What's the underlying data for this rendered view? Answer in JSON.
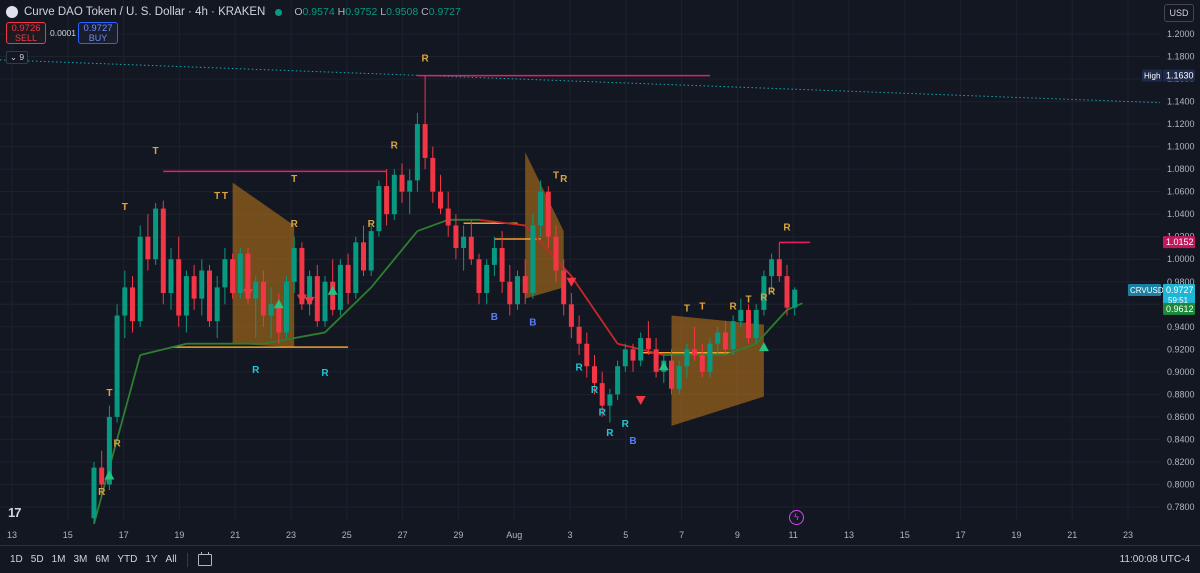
{
  "header": {
    "title": "Curve DAO Token / U. S. Dollar · 4h · KRAKEN",
    "ohlc": [
      {
        "k": "O",
        "v": "0.9574"
      },
      {
        "k": "H",
        "v": "0.9752"
      },
      {
        "k": "L",
        "v": "0.9508"
      },
      {
        "k": "C",
        "v": "0.9727"
      }
    ]
  },
  "trade": {
    "sell_price": "0.9726",
    "sell_label": "SELL",
    "spread": "0.0001",
    "buy_price": "0.9727",
    "buy_label": "BUY"
  },
  "indicators_toggle": "9",
  "currency": "USD",
  "colors": {
    "bg": "#131722",
    "up": "#089981",
    "down": "#f23645",
    "amber": "#d9a441",
    "magenta": "#e91e63",
    "orange": "#f59e2d",
    "cyan": "#22c6d6",
    "trail_green": "#2e7d32",
    "trail_red": "#c62828"
  },
  "chart_data": {
    "type": "candlestick",
    "ylim": [
      0.77,
      1.22
    ],
    "yticks": [
      "1.2000",
      "1.1800",
      "1.1600",
      "1.1400",
      "1.1200",
      "1.1000",
      "1.0800",
      "1.0600",
      "1.0400",
      "1.0200",
      "1.0000",
      "0.9800",
      "0.9600",
      "0.9400",
      "0.9200",
      "0.9000",
      "0.8800",
      "0.8600",
      "0.8400",
      "0.8200",
      "0.8000",
      "0.7800"
    ],
    "xticks": [
      "13",
      "15",
      "17",
      "19",
      "21",
      "23",
      "25",
      "27",
      "29",
      "Aug",
      "3",
      "5",
      "7",
      "9",
      "11",
      "13",
      "15",
      "17",
      "19",
      "21",
      "23"
    ],
    "price_labels": [
      {
        "name": "High",
        "value": "1.1630"
      },
      {
        "name": "",
        "value": "1.0152"
      },
      {
        "name": "CRVUSD",
        "value": "0.9727",
        "countdown": "59:51"
      },
      {
        "name": "",
        "value": "0.9612"
      }
    ],
    "candles": [
      [
        0.77,
        0.82,
        0.765,
        0.815
      ],
      [
        0.815,
        0.83,
        0.79,
        0.8
      ],
      [
        0.8,
        0.87,
        0.795,
        0.86
      ],
      [
        0.86,
        0.96,
        0.855,
        0.95
      ],
      [
        0.95,
        0.99,
        0.93,
        0.975
      ],
      [
        0.975,
        0.985,
        0.935,
        0.945
      ],
      [
        0.945,
        1.03,
        0.94,
        1.02
      ],
      [
        1.02,
        1.04,
        0.99,
        1.0
      ],
      [
        1.0,
        1.05,
        0.995,
        1.045
      ],
      [
        1.045,
        1.052,
        0.96,
        0.97
      ],
      [
        0.97,
        1.01,
        0.955,
        1.0
      ],
      [
        1.0,
        1.02,
        0.94,
        0.95
      ],
      [
        0.95,
        0.99,
        0.935,
        0.985
      ],
      [
        0.985,
        0.995,
        0.955,
        0.965
      ],
      [
        0.965,
        1.0,
        0.95,
        0.99
      ],
      [
        0.99,
        0.995,
        0.94,
        0.945
      ],
      [
        0.945,
        0.985,
        0.93,
        0.975
      ],
      [
        0.975,
        1.01,
        0.96,
        1.0
      ],
      [
        1.0,
        1.005,
        0.965,
        0.97
      ],
      [
        0.97,
        1.01,
        0.965,
        1.005
      ],
      [
        1.005,
        1.01,
        0.96,
        0.965
      ],
      [
        0.965,
        0.985,
        0.93,
        0.98
      ],
      [
        0.98,
        0.99,
        0.94,
        0.95
      ],
      [
        0.95,
        0.975,
        0.93,
        0.96
      ],
      [
        0.96,
        0.97,
        0.925,
        0.935
      ],
      [
        0.935,
        0.985,
        0.93,
        0.98
      ],
      [
        0.98,
        1.02,
        0.97,
        1.01
      ],
      [
        1.01,
        1.015,
        0.955,
        0.96
      ],
      [
        0.96,
        0.99,
        0.95,
        0.985
      ],
      [
        0.985,
        0.995,
        0.94,
        0.945
      ],
      [
        0.945,
        0.985,
        0.94,
        0.98
      ],
      [
        0.98,
        1.0,
        0.95,
        0.955
      ],
      [
        0.955,
        1.0,
        0.95,
        0.995
      ],
      [
        0.995,
        1.005,
        0.96,
        0.97
      ],
      [
        0.97,
        1.02,
        0.965,
        1.015
      ],
      [
        1.015,
        1.03,
        0.985,
        0.99
      ],
      [
        0.99,
        1.03,
        0.985,
        1.025
      ],
      [
        1.025,
        1.07,
        1.02,
        1.065
      ],
      [
        1.065,
        1.08,
        1.03,
        1.04
      ],
      [
        1.04,
        1.08,
        1.035,
        1.075
      ],
      [
        1.075,
        1.085,
        1.05,
        1.06
      ],
      [
        1.06,
        1.08,
        1.04,
        1.07
      ],
      [
        1.07,
        1.13,
        1.06,
        1.12
      ],
      [
        1.12,
        1.163,
        1.08,
        1.09
      ],
      [
        1.09,
        1.1,
        1.05,
        1.06
      ],
      [
        1.06,
        1.075,
        1.04,
        1.045
      ],
      [
        1.045,
        1.06,
        1.02,
        1.03
      ],
      [
        1.03,
        1.04,
        1.0,
        1.01
      ],
      [
        1.01,
        1.03,
        0.99,
        1.02
      ],
      [
        1.02,
        1.035,
        0.995,
        1.0
      ],
      [
        1.0,
        1.005,
        0.96,
        0.97
      ],
      [
        0.97,
        1.0,
        0.96,
        0.995
      ],
      [
        0.995,
        1.02,
        0.985,
        1.01
      ],
      [
        1.01,
        1.025,
        0.97,
        0.98
      ],
      [
        0.98,
        0.995,
        0.95,
        0.96
      ],
      [
        0.96,
        0.99,
        0.955,
        0.985
      ],
      [
        0.985,
        1.0,
        0.96,
        0.97
      ],
      [
        0.97,
        1.04,
        0.965,
        1.03
      ],
      [
        1.03,
        1.07,
        1.02,
        1.06
      ],
      [
        1.06,
        1.065,
        1.01,
        1.02
      ],
      [
        1.02,
        1.03,
        0.98,
        0.99
      ],
      [
        0.99,
        1.0,
        0.95,
        0.96
      ],
      [
        0.96,
        0.97,
        0.93,
        0.94
      ],
      [
        0.94,
        0.95,
        0.915,
        0.925
      ],
      [
        0.925,
        0.935,
        0.895,
        0.905
      ],
      [
        0.905,
        0.915,
        0.88,
        0.89
      ],
      [
        0.89,
        0.9,
        0.86,
        0.87
      ],
      [
        0.87,
        0.885,
        0.855,
        0.88
      ],
      [
        0.88,
        0.91,
        0.875,
        0.905
      ],
      [
        0.905,
        0.925,
        0.9,
        0.92
      ],
      [
        0.92,
        0.925,
        0.9,
        0.91
      ],
      [
        0.91,
        0.935,
        0.905,
        0.93
      ],
      [
        0.93,
        0.945,
        0.915,
        0.92
      ],
      [
        0.92,
        0.93,
        0.895,
        0.9
      ],
      [
        0.9,
        0.915,
        0.89,
        0.91
      ],
      [
        0.91,
        0.92,
        0.88,
        0.885
      ],
      [
        0.885,
        0.91,
        0.88,
        0.905
      ],
      [
        0.905,
        0.925,
        0.895,
        0.92
      ],
      [
        0.92,
        0.94,
        0.91,
        0.915
      ],
      [
        0.915,
        0.925,
        0.895,
        0.9
      ],
      [
        0.9,
        0.93,
        0.895,
        0.925
      ],
      [
        0.925,
        0.94,
        0.915,
        0.935
      ],
      [
        0.935,
        0.945,
        0.915,
        0.92
      ],
      [
        0.92,
        0.95,
        0.915,
        0.945
      ],
      [
        0.945,
        0.965,
        0.94,
        0.955
      ],
      [
        0.955,
        0.96,
        0.925,
        0.93
      ],
      [
        0.93,
        0.96,
        0.925,
        0.955
      ],
      [
        0.955,
        0.99,
        0.95,
        0.985
      ],
      [
        0.985,
        1.005,
        0.97,
        1.0
      ],
      [
        1.0,
        1.015,
        0.98,
        0.985
      ],
      [
        0.985,
        0.995,
        0.95,
        0.957
      ],
      [
        0.957,
        0.975,
        0.95,
        0.973
      ]
    ],
    "trail": [
      {
        "i": 0,
        "v": 0.765
      },
      {
        "i": 6,
        "v": 0.915
      },
      {
        "i": 12,
        "v": 0.925
      },
      {
        "i": 22,
        "v": 0.925
      },
      {
        "i": 30,
        "v": 0.935
      },
      {
        "i": 36,
        "v": 0.975
      },
      {
        "i": 42,
        "v": 1.025
      },
      {
        "i": 46,
        "v": 1.035
      },
      {
        "i": 50,
        "v": 1.035,
        "bear": true
      },
      {
        "i": 56,
        "v": 1.03,
        "bear": true
      },
      {
        "i": 62,
        "v": 0.985,
        "bear": true
      },
      {
        "i": 68,
        "v": 0.925,
        "bear": true
      },
      {
        "i": 71,
        "v": 0.92,
        "bear": true
      },
      {
        "i": 74,
        "v": 0.915
      },
      {
        "i": 82,
        "v": 0.915
      },
      {
        "i": 86,
        "v": 0.925
      },
      {
        "i": 90,
        "v": 0.955
      },
      {
        "i": 92,
        "v": 0.961
      }
    ],
    "levels": [
      {
        "i0": 9,
        "i1": 38,
        "v": 1.078,
        "color": "magenta"
      },
      {
        "i0": 42,
        "i1": 80,
        "v": 1.163,
        "color": "magenta"
      },
      {
        "i0": 89,
        "i1": 93,
        "v": 1.015,
        "color": "magenta"
      },
      {
        "i0": 10,
        "i1": 33,
        "v": 0.922,
        "color": "orange"
      },
      {
        "i0": 48,
        "i1": 55,
        "v": 1.032,
        "color": "orange"
      },
      {
        "i0": 52,
        "i1": 58,
        "v": 1.018,
        "color": "orange"
      },
      {
        "i0": 71,
        "i1": 83,
        "v": 0.917,
        "color": "orange"
      }
    ],
    "zones": [
      {
        "i0": 18,
        "i1": 26,
        "top": [
          1.068,
          1.03
        ],
        "bot": [
          0.925,
          0.922
        ]
      },
      {
        "i0": 56,
        "i1": 61,
        "top": [
          1.095,
          1.025
        ],
        "bot": [
          0.965,
          0.975
        ]
      },
      {
        "i0": 75,
        "i1": 87,
        "top": [
          0.95,
          0.942
        ],
        "bot": [
          0.852,
          0.878
        ]
      }
    ],
    "markers": [
      {
        "i": 1,
        "v": 0.787,
        "t": "R",
        "pos": "above",
        "c": "amber"
      },
      {
        "i": 3,
        "v": 0.83,
        "t": "R",
        "pos": "above",
        "c": "amber"
      },
      {
        "i": 2,
        "v": 0.875,
        "t": "T",
        "pos": "above",
        "c": "orange"
      },
      {
        "i": 4,
        "v": 1.04,
        "t": "T",
        "pos": "above",
        "c": "orange"
      },
      {
        "i": 8,
        "v": 1.09,
        "t": "T",
        "pos": "above",
        "c": "amber"
      },
      {
        "i": 16,
        "v": 1.05,
        "t": "T",
        "pos": "above",
        "c": "amber"
      },
      {
        "i": 17,
        "v": 1.05,
        "t": "T",
        "pos": "above",
        "c": "amber"
      },
      {
        "i": 26,
        "v": 1.065,
        "t": "T",
        "pos": "above",
        "c": "amber"
      },
      {
        "i": 26,
        "v": 1.025,
        "t": "R",
        "pos": "above",
        "c": "amber"
      },
      {
        "i": 36,
        "v": 1.025,
        "t": "R",
        "pos": "above",
        "c": "amber"
      },
      {
        "i": 39,
        "v": 1.095,
        "t": "R",
        "pos": "above",
        "c": "amber"
      },
      {
        "i": 43,
        "v": 1.172,
        "t": "R",
        "pos": "above",
        "c": "amber"
      },
      {
        "i": 60,
        "v": 1.068,
        "t": "T",
        "pos": "above",
        "c": "amber"
      },
      {
        "i": 61,
        "v": 1.065,
        "t": "R",
        "pos": "above",
        "c": "amber"
      },
      {
        "i": 77,
        "v": 0.95,
        "t": "T",
        "pos": "above",
        "c": "amber"
      },
      {
        "i": 79,
        "v": 0.952,
        "t": "T",
        "pos": "above",
        "c": "orange"
      },
      {
        "i": 83,
        "v": 0.952,
        "t": "R",
        "pos": "above",
        "c": "amber"
      },
      {
        "i": 85,
        "v": 0.958,
        "t": "T",
        "pos": "above",
        "c": "amber"
      },
      {
        "i": 87,
        "v": 0.96,
        "t": "R",
        "pos": "above",
        "c": "amber"
      },
      {
        "i": 88,
        "v": 0.965,
        "t": "R",
        "pos": "above",
        "c": "amber"
      },
      {
        "i": 90,
        "v": 1.022,
        "t": "R",
        "pos": "above",
        "c": "amber"
      },
      {
        "i": 21,
        "v": 0.908,
        "t": "R",
        "pos": "below",
        "c": "cyan"
      },
      {
        "i": 30,
        "v": 0.905,
        "t": "R",
        "pos": "below",
        "c": "cyan"
      },
      {
        "i": 52,
        "v": 0.955,
        "t": "B",
        "pos": "below",
        "c": "blue"
      },
      {
        "i": 57,
        "v": 0.95,
        "t": "B",
        "pos": "below",
        "c": "blue"
      },
      {
        "i": 63,
        "v": 0.91,
        "t": "R",
        "pos": "below",
        "c": "cyan"
      },
      {
        "i": 65,
        "v": 0.89,
        "t": "R",
        "pos": "below",
        "c": "cyan"
      },
      {
        "i": 66,
        "v": 0.87,
        "t": "R",
        "pos": "below",
        "c": "cyan"
      },
      {
        "i": 67,
        "v": 0.852,
        "t": "R",
        "pos": "below",
        "c": "cyan"
      },
      {
        "i": 69,
        "v": 0.86,
        "t": "R",
        "pos": "below",
        "c": "cyan"
      },
      {
        "i": 70,
        "v": 0.845,
        "t": "B",
        "pos": "below",
        "c": "blue"
      }
    ],
    "arrows": [
      {
        "i": 2,
        "v": 0.808,
        "dir": "up"
      },
      {
        "i": 24,
        "v": 0.96,
        "dir": "up"
      },
      {
        "i": 31,
        "v": 0.972,
        "dir": "up"
      },
      {
        "i": 74,
        "v": 0.905,
        "dir": "up"
      },
      {
        "i": 87,
        "v": 0.922,
        "dir": "up"
      },
      {
        "i": 20,
        "v": 0.97,
        "dir": "down"
      },
      {
        "i": 27,
        "v": 0.965,
        "dir": "down"
      },
      {
        "i": 28,
        "v": 0.963,
        "dir": "down"
      },
      {
        "i": 62,
        "v": 0.98,
        "dir": "down"
      },
      {
        "i": 71,
        "v": 0.875,
        "dir": "down"
      }
    ]
  },
  "bottom": {
    "ranges": [
      "1D",
      "5D",
      "1M",
      "3M",
      "6M",
      "YTD",
      "1Y",
      "All"
    ],
    "time": "11:00:08 UTC-4"
  }
}
